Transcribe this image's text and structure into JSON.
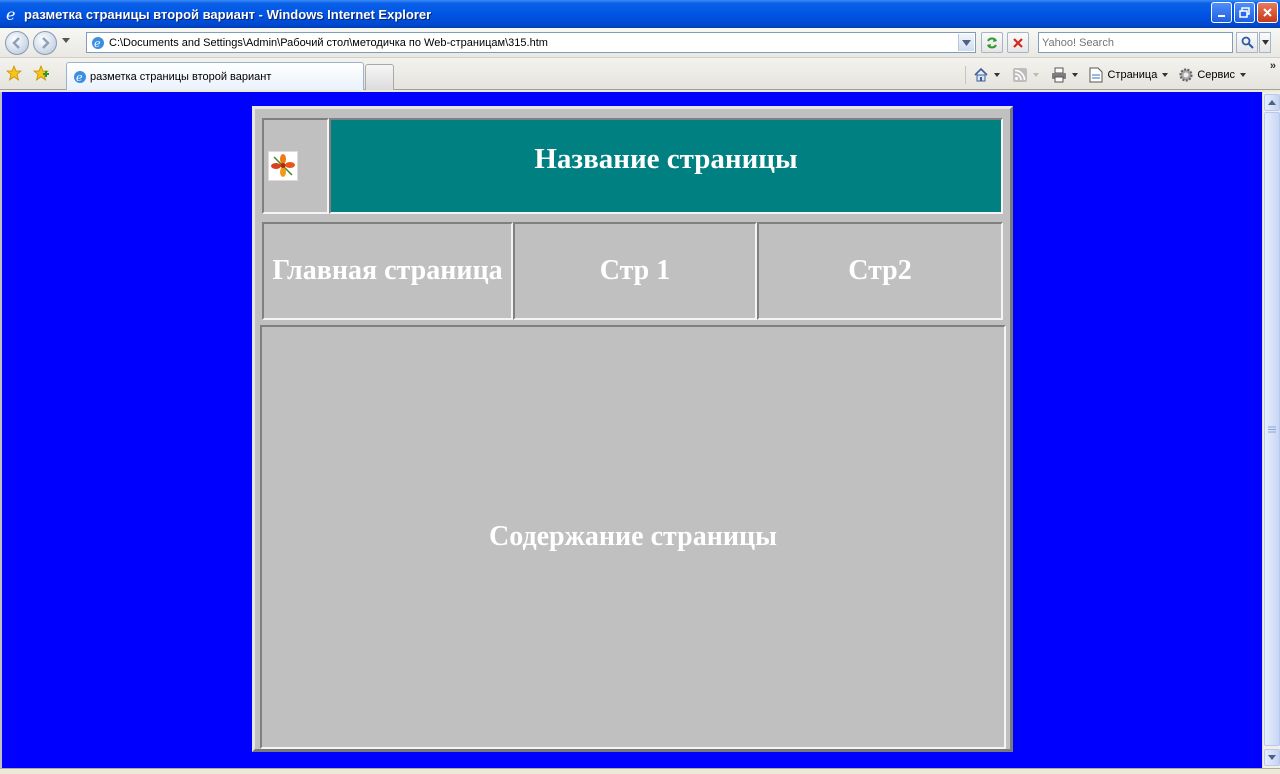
{
  "window": {
    "title": "разметка страницы второй вариант - Windows Internet Explorer"
  },
  "nav": {
    "address": "C:\\Documents and Settings\\Admin\\Рабочий стол\\методичка по Web-страницам\\315.htm",
    "search_placeholder": "Yahoo! Search"
  },
  "tabs": {
    "active_label": "разметка страницы второй вариант"
  },
  "commandbar": {
    "page_label": "Страница",
    "tools_label": "Сервис"
  },
  "page": {
    "title": "Название страницы",
    "nav_items": [
      "Главная страница",
      "Стр 1",
      "Стр2"
    ],
    "content": "Содержание страницы",
    "colors": {
      "background": "#0000ff",
      "header": "#008080",
      "table": "#c0c0c0",
      "text": "#ffffff"
    }
  }
}
